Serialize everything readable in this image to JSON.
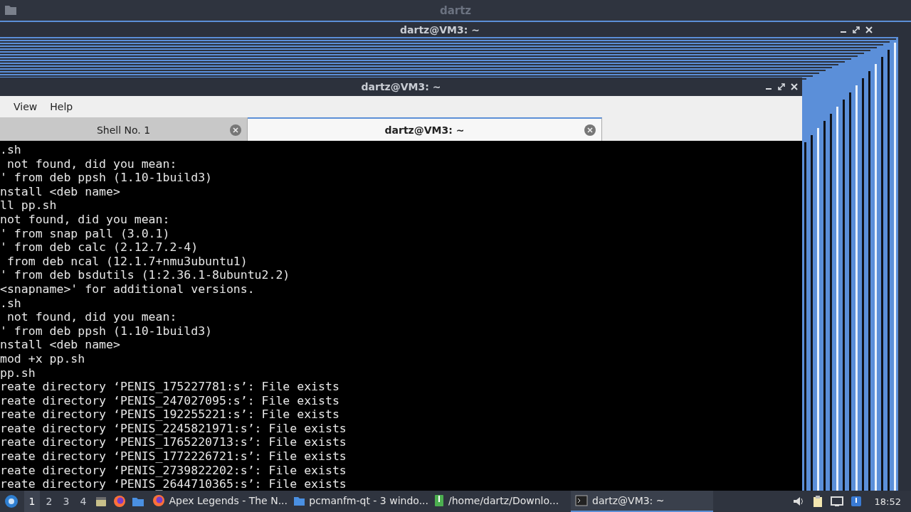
{
  "desktop_title": "dartz",
  "back_window": {
    "title": "dartz@VM3: ~"
  },
  "window": {
    "title": "dartz@VM3: ~"
  },
  "menu": [
    "View",
    "Help"
  ],
  "tabs": [
    {
      "label": "Shell No. 1",
      "selected": false
    },
    {
      "label": "dartz@VM3: ~",
      "selected": true
    }
  ],
  "terminal_lines": [
    ".sh",
    " not found, did you mean:",
    "' from deb ppsh (1.10-1build3)",
    "nstall <deb name>",
    "ll pp.sh",
    "not found, did you mean:",
    "' from snap pall (3.0.1)",
    "' from deb calc (2.12.7.2-4)",
    " from deb ncal (12.1.7+nmu3ubuntu1)",
    "' from deb bsdutils (1:2.36.1-8ubuntu2.2)",
    "<snapname>' for additional versions.",
    ".sh",
    " not found, did you mean:",
    "' from deb ppsh (1.10-1build3)",
    "nstall <deb name>",
    "mod +x pp.sh",
    "pp.sh",
    "reate directory ‘PENIS_175227781:s’: File exists",
    "reate directory ‘PENIS_247027095:s’: File exists",
    "reate directory ‘PENIS_192255221:s’: File exists",
    "reate directory ‘PENIS_2245821971:s’: File exists",
    "reate directory ‘PENIS_1765220713:s’: File exists",
    "reate directory ‘PENIS_1772226721:s’: File exists",
    "reate directory ‘PENIS_2739822202:s’: File exists",
    "reate directory ‘PENIS_2644710365:s’: File exists"
  ],
  "taskbar": {
    "workspaces": [
      {
        "label": "1",
        "selected": true
      },
      {
        "label": "2",
        "selected": false
      },
      {
        "label": "3",
        "selected": false
      },
      {
        "label": "4",
        "selected": false
      }
    ],
    "launchers": [
      {
        "kind": "files"
      },
      {
        "kind": "browser"
      },
      {
        "kind": "folder"
      }
    ],
    "tasks": [
      {
        "kind": "browser",
        "title": "Apex Legends - The N...",
        "selected": false
      },
      {
        "kind": "folder",
        "title": "pcmanfm-qt - 3 windo...",
        "selected": false
      },
      {
        "kind": "archive",
        "title": "/home/dartz/Downlo...",
        "selected": false
      },
      {
        "kind": "terminal",
        "title": "dartz@VM3: ~",
        "selected": true
      }
    ],
    "clock": "18:52"
  }
}
